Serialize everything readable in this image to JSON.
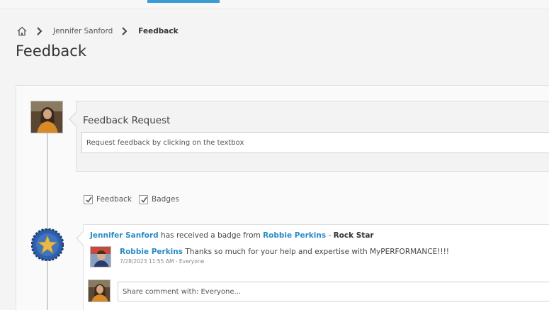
{
  "breadcrumb": {
    "home_icon": "home-icon",
    "items": [
      "Jennifer Sanford",
      "Feedback"
    ]
  },
  "page": {
    "title": "Feedback"
  },
  "request": {
    "title": "Feedback Request",
    "placeholder": "Request feedback by clicking on the textbox"
  },
  "filters": {
    "feedback_label": "Feedback",
    "badges_label": "Badges",
    "feedback_checked": true,
    "badges_checked": true
  },
  "post": {
    "recipient": "Jennifer Sanford",
    "action_text": " has received a badge from ",
    "giver": "Robbie Perkins",
    "separator": " - ",
    "badge_name": "Rock Star",
    "comment_author": "Robbie Perkins",
    "comment_text": " Thanks so much for your help and expertise with MyPERFORMANCE!!!!",
    "comment_meta": "7/28/2023 11:55 AM - Everyone",
    "reply_placeholder": "Share comment with: Everyone..."
  },
  "colors": {
    "accent": "#3a9bd5",
    "link": "#2a8bc7"
  }
}
